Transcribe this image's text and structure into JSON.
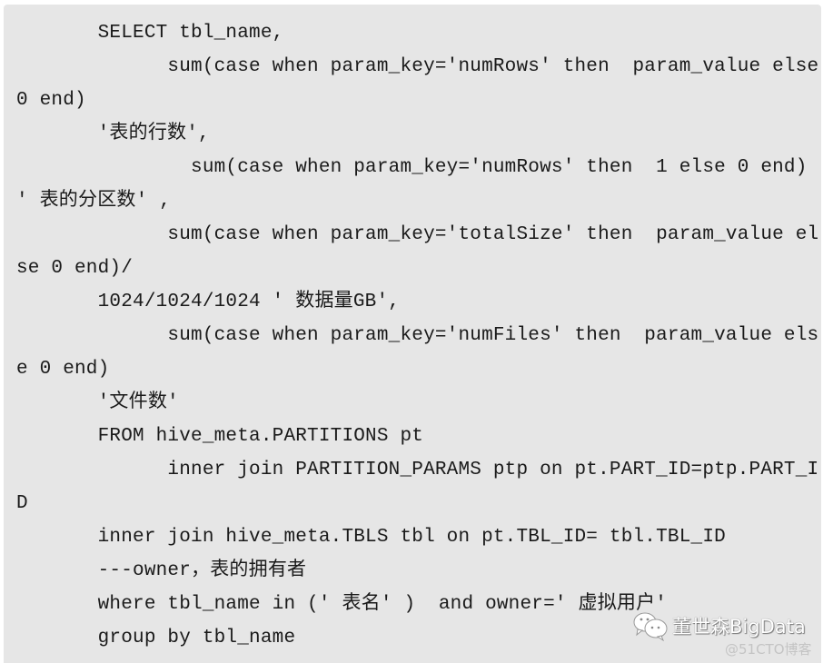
{
  "code": {
    "language": "SQL",
    "lines": [
      "       SELECT tbl_name,",
      "             sum(case when param_key='numRows' then  param_value else",
      "0 end)",
      "       '表的行数',",
      "               sum(case when param_key='numRows' then  1 else 0 end)",
      "' 表的分区数' ,",
      "             sum(case when param_key='totalSize' then  param_value el",
      "se 0 end)/",
      "       1024/1024/1024 ' 数据量GB',",
      "             sum(case when param_key='numFiles' then  param_value els",
      "e 0 end)",
      "       '文件数'",
      "       FROM hive_meta.PARTITIONS pt",
      "             inner join PARTITION_PARAMS ptp on pt.PART_ID=ptp.PART_I",
      "D",
      "       inner join hive_meta.TBLS tbl on pt.TBL_ID= tbl.TBL_ID",
      "       ---owner，表的拥有者",
      "       where tbl_name in (' 表名' )  and owner=' 虚拟用户'",
      "       group by tbl_name"
    ]
  },
  "watermark": {
    "icon": "wechat-icon",
    "title": "董世森BigData",
    "subtitle": "@51CTO博客"
  },
  "colors": {
    "background": "#e6e6e6",
    "text": "#1a1a1a"
  }
}
